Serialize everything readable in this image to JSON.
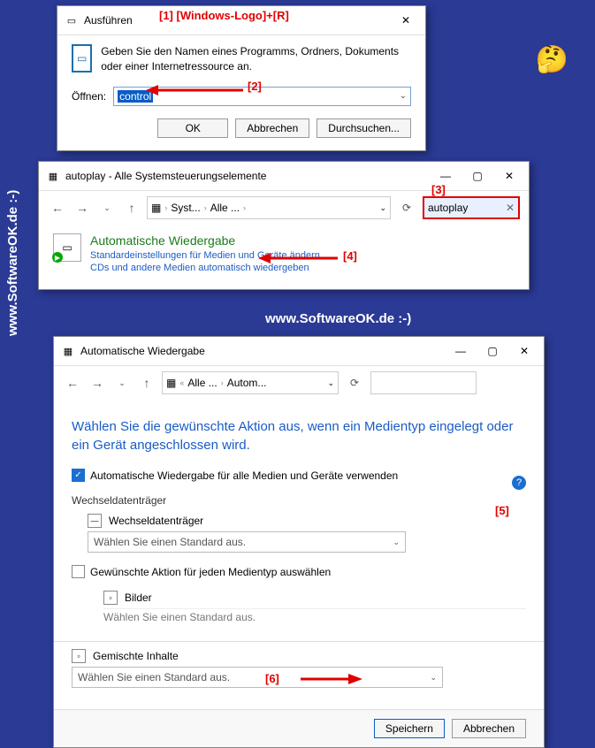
{
  "watermark": "www.SoftwareOK.de :-)",
  "annotations": {
    "a1": "[1] [Windows-Logo]+[R]",
    "a2": "[2]",
    "a3": "[3]",
    "a4": "[4]",
    "a5": "[5]",
    "a6": "[6]"
  },
  "run": {
    "title": "Ausführen",
    "desc": "Geben Sie den Namen eines Programms, Ordners, Dokuments oder einer Internetressource an.",
    "label": "Öffnen:",
    "value": "control",
    "ok": "OK",
    "cancel": "Abbrechen",
    "browse": "Durchsuchen..."
  },
  "cp": {
    "title": "autoplay - Alle Systemsteuerungselemente",
    "bc1": "Syst...",
    "bc2": "Alle ...",
    "search": "autoplay",
    "result_title": "Automatische Wiedergabe",
    "result_line1": "Standardeinstellungen für Medien und Geräte ändern",
    "result_line2": "CDs und andere Medien automatisch wiedergeben"
  },
  "ap": {
    "title": "Automatische Wiedergabe",
    "bc1": "Alle ...",
    "bc2": "Autom...",
    "heading": "Wählen Sie die gewünschte Aktion aus, wenn ein Medientyp eingelegt oder ein Gerät angeschlossen wird.",
    "checkbox_all": "Automatische Wiedergabe für alle Medien und Geräte verwenden",
    "section1": "Wechseldatenträger",
    "sub1": "Wechseldatenträger",
    "dd_default": "Wählen Sie einen Standard aus.",
    "checkbox_each": "Gewünschte Aktion für jeden Medientyp auswählen",
    "sub2": "Bilder",
    "section3": "Gemischte Inhalte",
    "save": "Speichern",
    "cancel": "Abbrechen"
  }
}
